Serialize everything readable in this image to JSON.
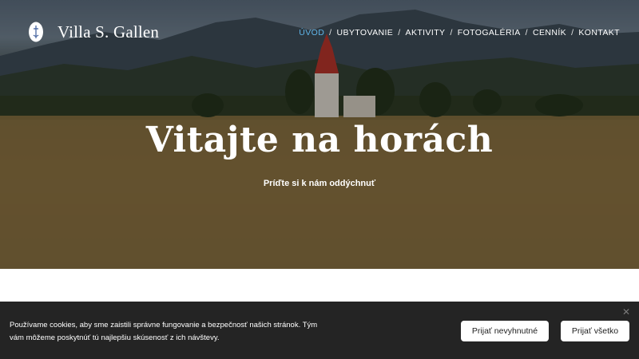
{
  "header": {
    "brand_name": "Villa S. Gallen",
    "logo_icon": "villa-logo-icon",
    "nav": [
      {
        "label": "ÚVOD",
        "active": true
      },
      {
        "label": "UBYTOVANIE",
        "active": false
      },
      {
        "label": "AKTIVITY",
        "active": false
      },
      {
        "label": "FOTOGALÉRIA",
        "active": false
      },
      {
        "label": "CENNÍK",
        "active": false
      },
      {
        "label": "KONTAKT",
        "active": false
      }
    ],
    "nav_separator": "/"
  },
  "hero": {
    "title": "Vitajte na horách",
    "subtitle": "Príďte si k nám oddýchnuť"
  },
  "cookie": {
    "text": "Používame cookies, aby sme zaistili správne fungovanie a bezpečnosť našich stránok. Tým vám môžeme poskytnúť tú najlepšiu skúsenosť z ich návštevy.",
    "necessary_label": "Prijať nevyhnutné",
    "all_label": "Prijať všetko",
    "close_icon": "close-icon"
  },
  "colors": {
    "nav_active": "#5fb4e8",
    "cookie_bg": "#242424"
  }
}
